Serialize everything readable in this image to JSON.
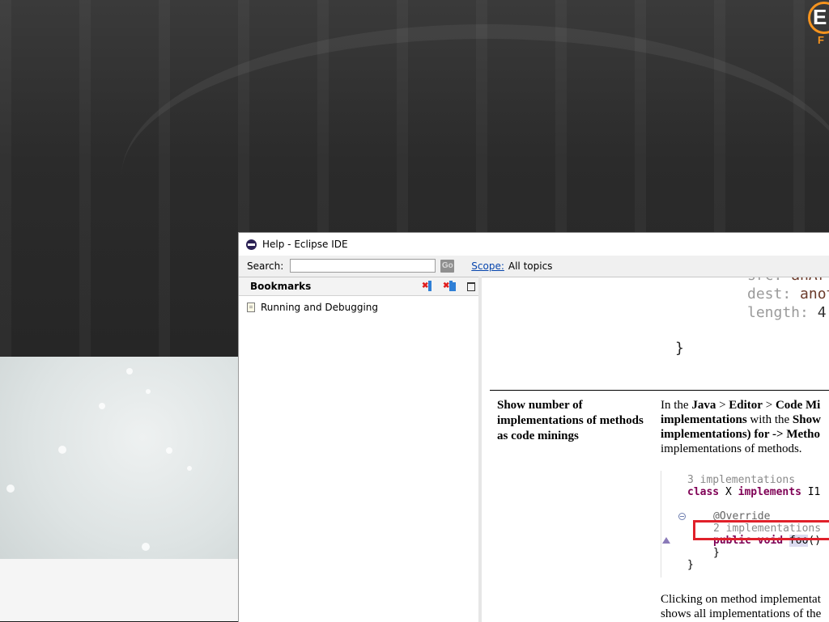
{
  "background": {
    "logo": {
      "letter": "E",
      "sub": "F"
    }
  },
  "window": {
    "title": "Help - Eclipse IDE",
    "search": {
      "label": "Search:",
      "value": "",
      "go_label": "Go"
    },
    "scope": {
      "link": "Scope:",
      "value": "All topics"
    }
  },
  "bookmarks": {
    "title": "Bookmarks",
    "items": [
      {
        "label": "Running and Debugging",
        "icon": "doc-icon"
      }
    ],
    "tools": [
      "delete-bookmark-icon",
      "delete-all-bookmarks-icon",
      "maximize-icon"
    ]
  },
  "content": {
    "code_top": [
      {
        "key": "src: ",
        "value": "anAr"
      },
      {
        "key": "dest: ",
        "value": "anot"
      },
      {
        "key": "length: ",
        "value": "4"
      }
    ],
    "brace": "}",
    "feature_title": "Show number of implementations of methods as code minings",
    "desc_lines": [
      {
        "parts": [
          [
            "In the ",
            false
          ],
          [
            "Java",
            true
          ],
          [
            " > ",
            false
          ],
          [
            "Editor",
            true
          ],
          [
            " > ",
            false
          ],
          [
            "Code Mi",
            true
          ]
        ]
      },
      {
        "parts": [
          [
            "implementations",
            true
          ],
          [
            " with the ",
            false
          ],
          [
            "Show",
            true
          ]
        ]
      },
      {
        "parts": [
          [
            "implementations) for -> Metho",
            true
          ]
        ]
      },
      {
        "parts": [
          [
            "implementations of methods.",
            false
          ]
        ]
      }
    ],
    "code_example": {
      "line1": "3 implementations",
      "line2_kw": "class",
      "line2_name": " X ",
      "line2_kw2": "implements",
      "line2_rest": " I1",
      "line3": "@Override",
      "line4": "2 implementations",
      "line5_kw": "public void",
      "line5_space": " ",
      "line5_method": "foo",
      "line5_rest": "()",
      "line6": "}",
      "line7": "}"
    },
    "clicking_lines": [
      "Clicking on method implementat",
      "shows all implementations of the"
    ]
  }
}
